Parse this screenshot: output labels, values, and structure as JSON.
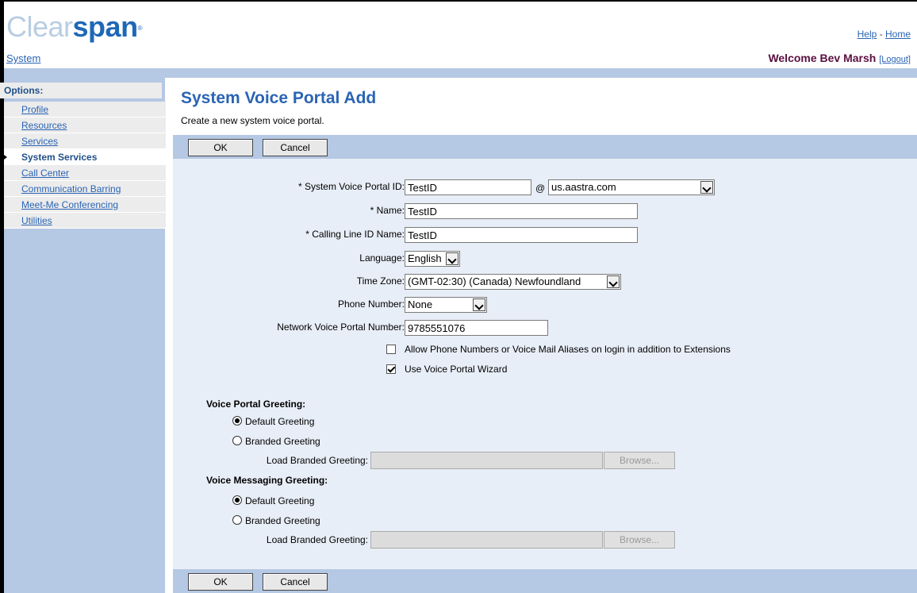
{
  "header": {
    "logo_light": "Clear",
    "logo_bold": "span",
    "logo_mark": "®",
    "help_link": "Help",
    "separator": "-",
    "home_link": "Home",
    "breadcrumb": "System",
    "welcome": "Welcome Bev Marsh",
    "logout": "[Logout]"
  },
  "sidebar": {
    "heading": "Options:",
    "items": [
      {
        "label": "Profile"
      },
      {
        "label": "Resources"
      },
      {
        "label": "Services"
      },
      {
        "label": "System Services"
      },
      {
        "label": "Call Center"
      },
      {
        "label": "Communication Barring"
      },
      {
        "label": "Meet-Me Conferencing"
      },
      {
        "label": "Utilities"
      }
    ]
  },
  "page": {
    "title": "System Voice Portal Add",
    "description": "Create a new system voice portal."
  },
  "buttons": {
    "ok": "OK",
    "cancel": "Cancel"
  },
  "form": {
    "portal_id_label": "* System Voice Portal ID:",
    "portal_id_value": "TestID",
    "at_sign": "@",
    "domain_value": "us.aastra.com",
    "name_label": "* Name:",
    "name_value": "TestID",
    "clid_label": "* Calling Line ID Name:",
    "clid_value": "TestID",
    "language_label": "Language:",
    "language_value": "English",
    "timezone_label": "Time Zone:",
    "timezone_value": "(GMT-02:30) (Canada) Newfoundland",
    "phone_label": "Phone Number:",
    "phone_value": "None",
    "network_label": "Network Voice Portal Number:",
    "network_value": "9785551076",
    "allow_aliases_label": "Allow Phone Numbers or Voice Mail Aliases on login in addition to Extensions",
    "allow_aliases_checked": false,
    "wizard_label": "Use Voice Portal Wizard",
    "wizard_checked": true
  },
  "voice_portal_greeting": {
    "heading": "Voice Portal Greeting:",
    "default_label": "Default Greeting",
    "branded_label": "Branded Greeting",
    "selected": "default",
    "load_label": "Load Branded Greeting:",
    "browse": "Browse..."
  },
  "voice_messaging_greeting": {
    "heading": "Voice Messaging Greeting:",
    "default_label": "Default Greeting",
    "branded_label": "Branded Greeting",
    "selected": "default",
    "load_label": "Load Branded Greeting:",
    "browse": "Browse..."
  },
  "colors": {
    "brand_blue": "#2a64b4",
    "panel_blue": "#b5c8e4",
    "form_bg": "#e8eef7",
    "welcome_text": "#5a1040"
  }
}
